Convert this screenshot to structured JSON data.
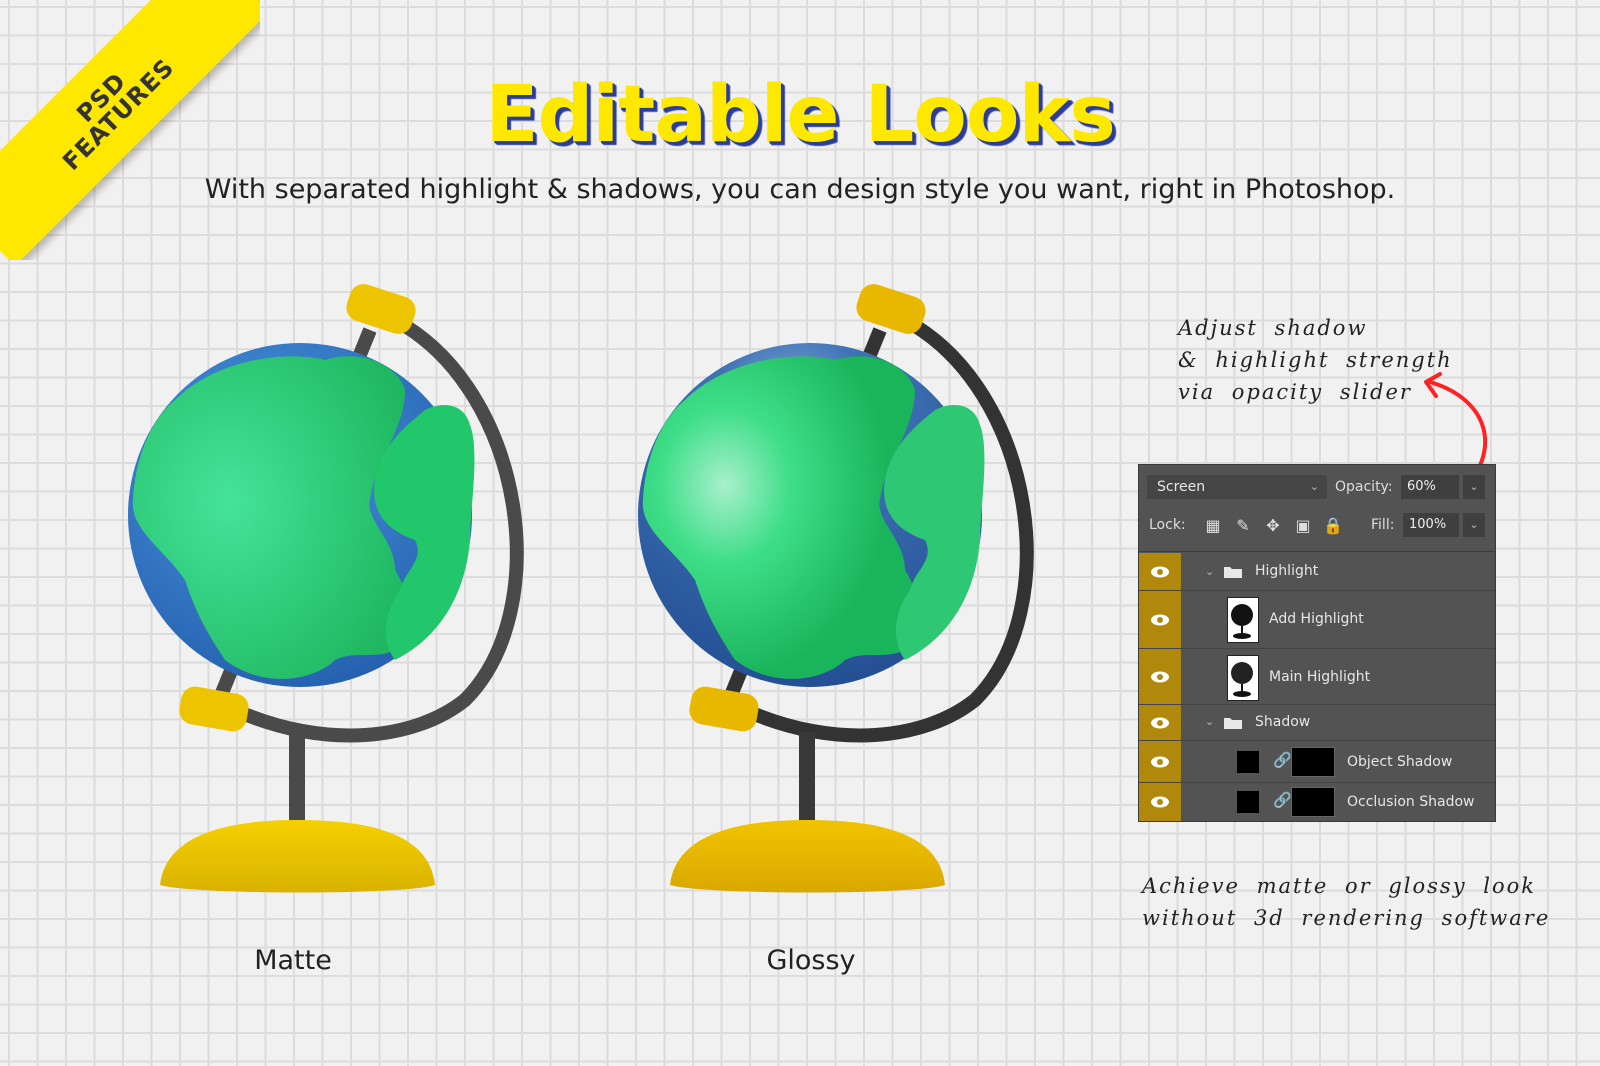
{
  "ribbon": {
    "line1": "PSD",
    "line2": "FEATURES",
    "color": "#ffe800"
  },
  "header": {
    "title": "Editable Looks",
    "subtitle": "With separated highlight & shadows, you can design style you want, right in Photoshop."
  },
  "globes": [
    {
      "caption": "Matte",
      "style": "matte"
    },
    {
      "caption": "Glossy",
      "style": "glossy"
    }
  ],
  "notes": {
    "top": [
      "Adjust shadow",
      "& highlight strength",
      "via opacity slider"
    ],
    "bottom": [
      "Achieve matte or glossy look",
      "without 3d rendering software"
    ]
  },
  "layers_panel": {
    "blend_mode": "Screen",
    "opacity_label": "Opacity:",
    "opacity_value": "60%",
    "lock_label": "Lock:",
    "lock_icons": [
      "lock-transparent-pixels-icon",
      "lock-image-pixels-icon",
      "lock-position-icon",
      "lock-artboard-icon",
      "lock-all-icon"
    ],
    "fill_label": "Fill:",
    "fill_value": "100%",
    "layers": [
      {
        "name": "Highlight",
        "type": "group",
        "visible": true
      },
      {
        "name": "Add Highlight",
        "type": "layer",
        "visible": true
      },
      {
        "name": "Main Highlight",
        "type": "layer",
        "visible": true
      },
      {
        "name": "Shadow",
        "type": "group",
        "visible": true
      },
      {
        "name": "Object Shadow",
        "type": "masked-layer",
        "visible": true
      },
      {
        "name": "Occlusion Shadow",
        "type": "masked-layer",
        "visible": true
      }
    ],
    "accent": "#b0880b"
  },
  "colors": {
    "ocean": "#2f74c4",
    "land": "#22c66b",
    "stand": "#4a4a4a",
    "base": "#ecc400",
    "arrow": "#ff2222"
  }
}
